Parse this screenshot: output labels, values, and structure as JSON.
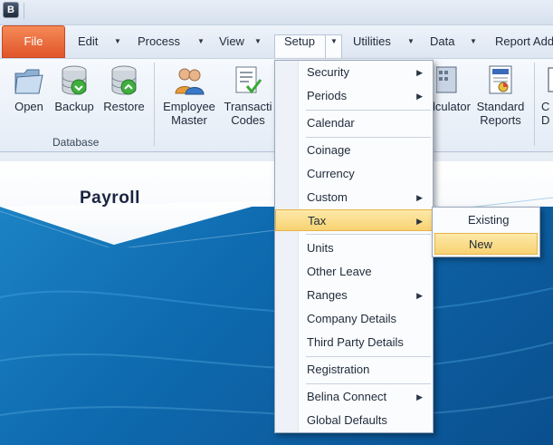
{
  "title_bar": {
    "app_icon": "payroll-app-icon"
  },
  "menu": {
    "file": "File",
    "items": [
      {
        "label": "Edit"
      },
      {
        "label": "Process"
      },
      {
        "label": "View"
      },
      {
        "label": "Setup"
      },
      {
        "label": "Utilities"
      },
      {
        "label": "Data"
      },
      {
        "label": "Report Add"
      }
    ]
  },
  "ribbon": {
    "database_group": {
      "label": "Database",
      "open": "Open",
      "backup": "Backup",
      "restore": "Restore"
    },
    "employee_master": [
      "Employee",
      "Master"
    ],
    "transaction_codes": [
      "Transacti",
      "Codes"
    ],
    "calculator": "lculator",
    "standard_reports": [
      "Standard",
      "Reports"
    ],
    "cut_off": [
      "C",
      "D"
    ]
  },
  "main": {
    "title": "Payroll"
  },
  "setup_menu": {
    "items": [
      {
        "label": "Security",
        "has_submenu": true
      },
      {
        "label": "Periods",
        "has_submenu": true
      },
      {
        "label": "Calendar",
        "has_submenu": false
      },
      {
        "label": "Coinage",
        "has_submenu": false
      },
      {
        "label": "Currency",
        "has_submenu": false
      },
      {
        "label": "Custom",
        "has_submenu": true
      },
      {
        "label": "Tax",
        "has_submenu": true,
        "highlighted": true
      },
      {
        "label": "Units",
        "has_submenu": false
      },
      {
        "label": "Other Leave",
        "has_submenu": false
      },
      {
        "label": "Ranges",
        "has_submenu": true
      },
      {
        "label": "Company Details",
        "has_submenu": false
      },
      {
        "label": "Third Party Details",
        "has_submenu": false
      },
      {
        "label": "Registration",
        "has_submenu": false
      },
      {
        "label": "Belina Connect",
        "has_submenu": true
      },
      {
        "label": "Global Defaults",
        "has_submenu": false
      }
    ]
  },
  "tax_submenu": {
    "items": [
      {
        "label": "Existing"
      },
      {
        "label": "New",
        "highlighted": true
      }
    ]
  },
  "colors": {
    "file_button": "#e8693a",
    "highlight": "#f9d98a",
    "background_blue": "#0f6bb0"
  }
}
